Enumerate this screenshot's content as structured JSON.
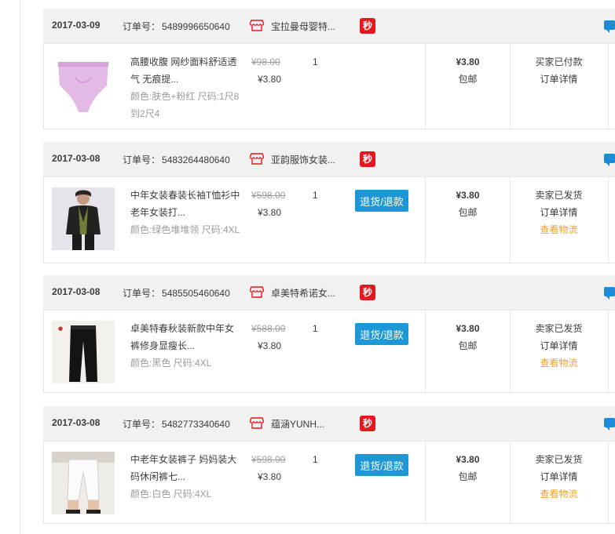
{
  "order_number_label": "订单号：",
  "badge_miao": "秒",
  "colors": {
    "header_bg": "#f1f1f1",
    "badge": "#e4161e",
    "button": "#1d97d5",
    "logistics": "#f0a026",
    "chat": "#1d8bd8"
  },
  "orders": [
    {
      "date": "2017-03-09",
      "order_no": "5489996650640",
      "shop": "宝拉曼母婴特...",
      "title": "高腰收腹 网纱面料舒适透气 无痕提...",
      "attrs": "颜色:肤色+粉红   尺码:1尺8到2尺4",
      "price_orig": "¥98.00",
      "price_now": "¥3.80",
      "qty": "1",
      "pay": "¥3.80",
      "ship": "包邮",
      "status": "买家已付款",
      "detail": "订单详情",
      "logistics": "",
      "refund": "",
      "thumb_icon": "underwear-thumbnail"
    },
    {
      "date": "2017-03-08",
      "order_no": "5483264480640",
      "shop": "亚韵服饰女装...",
      "title": "中年女装春装长袖T恤衫中老年女装打...",
      "attrs": "颜色:绿色堆堆领   尺码:4XL",
      "price_orig": "¥598.00",
      "price_now": "¥3.80",
      "qty": "1",
      "pay": "¥3.80",
      "ship": "包邮",
      "status": "卖家已发货",
      "detail": "订单详情",
      "logistics": "查看物流",
      "refund": "退货/退款",
      "thumb_icon": "blouse-thumbnail"
    },
    {
      "date": "2017-03-08",
      "order_no": "5485505460640",
      "shop": "卓美特希诺女...",
      "title": "卓美特春秋装新款中年女裤修身显瘦长...",
      "attrs": "颜色:黑色   尺码:4XL",
      "price_orig": "¥588.00",
      "price_now": "¥3.80",
      "qty": "1",
      "pay": "¥3.80",
      "ship": "包邮",
      "status": "卖家已发货",
      "detail": "订单详情",
      "logistics": "查看物流",
      "refund": "退货/退款",
      "thumb_icon": "black-pants-thumbnail"
    },
    {
      "date": "2017-03-08",
      "order_no": "5482773340640",
      "shop": "蕴涵YUNH...",
      "title": "中老年女装裤子 妈妈装大码休闲裤七...",
      "attrs": "颜色:白色   尺码:4XL",
      "price_orig": "¥598.00",
      "price_now": "¥3.80",
      "qty": "1",
      "pay": "¥3.80",
      "ship": "包邮",
      "status": "卖家已发货",
      "detail": "订单详情",
      "logistics": "查看物流",
      "refund": "退货/退款",
      "thumb_icon": "white-pants-thumbnail"
    }
  ]
}
